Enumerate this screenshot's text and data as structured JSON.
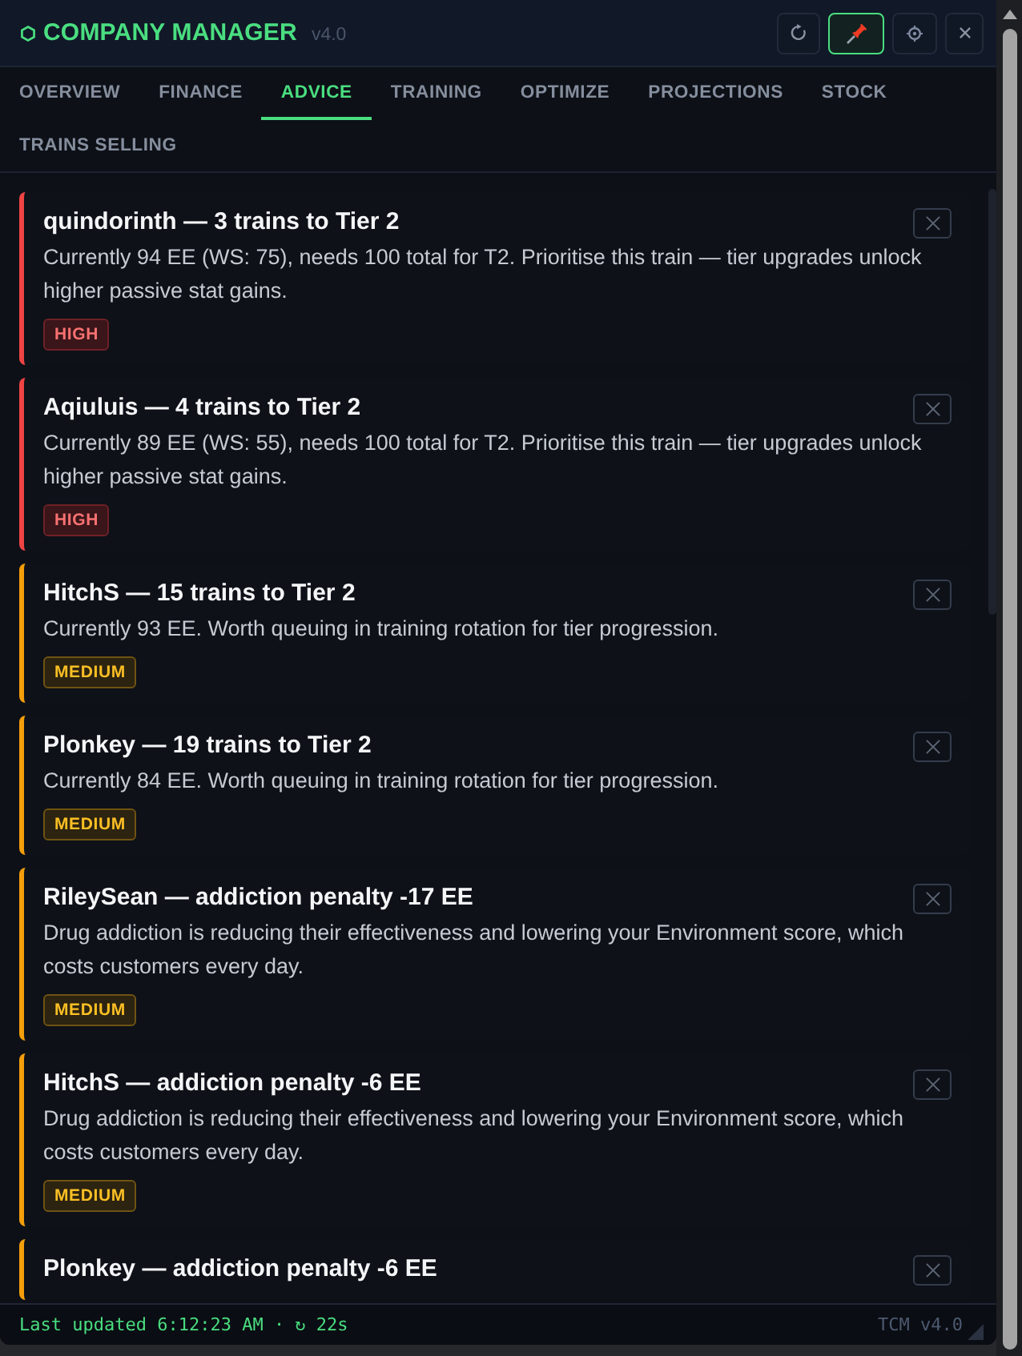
{
  "header": {
    "title": "COMPANY MANAGER",
    "version": "v4.0",
    "buttons": [
      {
        "kind": "refresh",
        "on": false
      },
      {
        "kind": "pin",
        "on": true
      },
      {
        "kind": "settings",
        "on": false
      },
      {
        "kind": "close",
        "on": false
      }
    ]
  },
  "tabs": [
    {
      "label": "OVERVIEW",
      "selected": false
    },
    {
      "label": "FINANCE",
      "selected": false
    },
    {
      "label": "ADVICE",
      "selected": true
    },
    {
      "label": "TRAINING",
      "selected": false
    },
    {
      "label": "OPTIMIZE",
      "selected": false
    },
    {
      "label": "PROJECTIONS",
      "selected": false
    },
    {
      "label": "STOCK",
      "selected": false
    },
    {
      "label": "TRAINS SELLING",
      "selected": false
    }
  ],
  "advice": [
    {
      "kind": "high",
      "title": "quindorinth — 3 trains to Tier 2",
      "body": "Currently 94 EE (WS: 75), needs 100 total for T2. Prioritise this train — tier upgrades unlock higher passive stat gains.",
      "badge": "HIGH"
    },
    {
      "kind": "high",
      "title": "Aqiuluis — 4 trains to Tier 2",
      "body": "Currently 89 EE (WS: 55), needs 100 total for T2. Prioritise this train — tier upgrades unlock higher passive stat gains.",
      "badge": "HIGH"
    },
    {
      "kind": "medium",
      "title": "HitchS — 15 trains to Tier 2",
      "body": "Currently 93 EE. Worth queuing in training rotation for tier progression.",
      "badge": "MEDIUM"
    },
    {
      "kind": "medium",
      "title": "Plonkey — 19 trains to Tier 2",
      "body": "Currently 84 EE. Worth queuing in training rotation for tier progression.",
      "badge": "MEDIUM"
    },
    {
      "kind": "medium",
      "title": "RileySean — addiction penalty -17 EE",
      "body": "Drug addiction is reducing their effectiveness and lowering your Environment score, which costs customers every day.",
      "badge": "MEDIUM"
    },
    {
      "kind": "medium",
      "title": "HitchS — addiction penalty -6 EE",
      "body": "Drug addiction is reducing their effectiveness and lowering your Environment score, which costs customers every day.",
      "badge": "MEDIUM"
    },
    {
      "kind": "medium",
      "title": "Plonkey — addiction penalty -6 EE"
    }
  ],
  "status_bar": {
    "text": "Last updated 6:12:23 AM · ↻ 22s",
    "version": "TCM v4.0"
  }
}
